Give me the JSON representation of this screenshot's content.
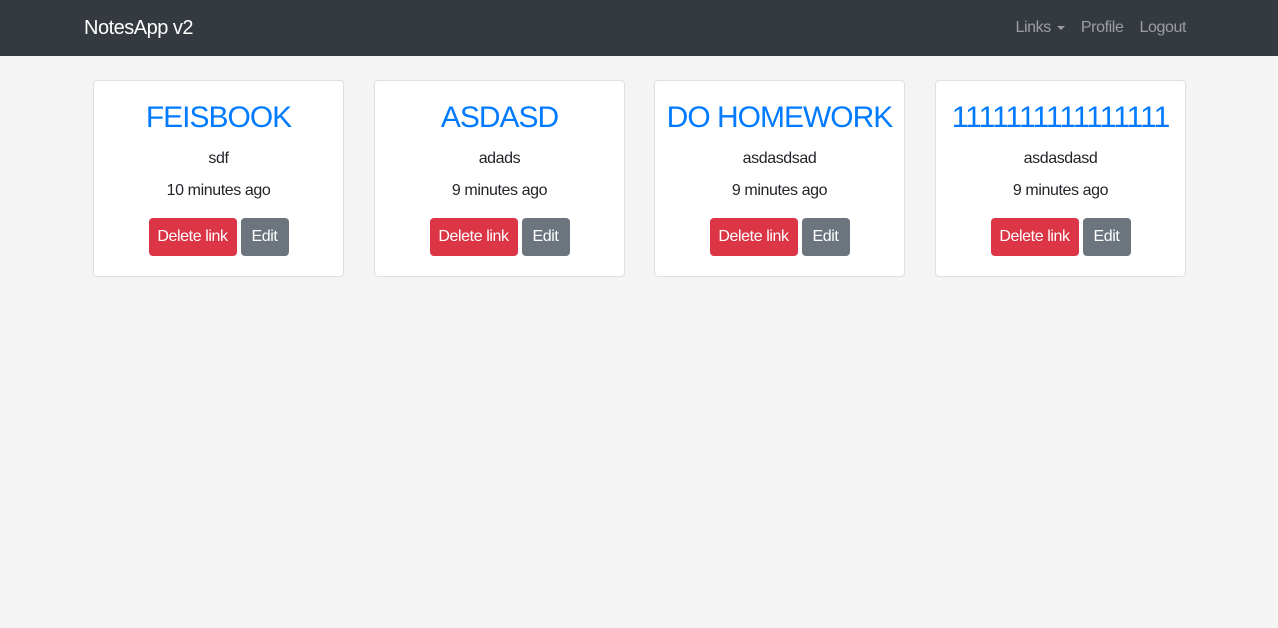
{
  "navbar": {
    "brand": "NotesApp v2",
    "links_label": "Links",
    "profile_label": "Profile",
    "logout_label": "Logout"
  },
  "cards": [
    {
      "title": "FEISBOOK",
      "description": "sdf",
      "time": "10 minutes ago",
      "delete_label": "Delete link",
      "edit_label": "Edit"
    },
    {
      "title": "ASDASD",
      "description": "adads",
      "time": "9 minutes ago",
      "delete_label": "Delete link",
      "edit_label": "Edit"
    },
    {
      "title": "DO HOMEWORK",
      "description": "asdasdsad",
      "time": "9 minutes ago",
      "delete_label": "Delete link",
      "edit_label": "Edit"
    },
    {
      "title": "1111111111111111",
      "description": "asdasdasd",
      "time": "9 minutes ago",
      "delete_label": "Delete link",
      "edit_label": "Edit"
    }
  ],
  "colors": {
    "navbar_bg": "#343a40",
    "title_link": "#007bff",
    "danger": "#dc3545",
    "secondary": "#6c757d",
    "page_bg": "#f4f4f4"
  }
}
